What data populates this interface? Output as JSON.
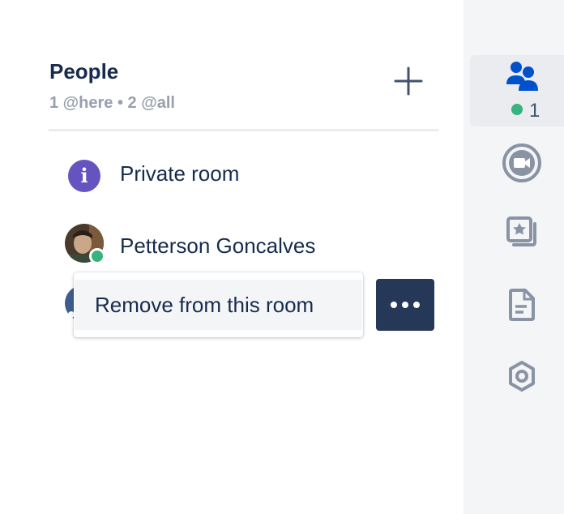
{
  "people_panel": {
    "title": "People",
    "subtitle": "1 @here • 2 @all",
    "add_icon": "plus-icon"
  },
  "rows": [
    {
      "label": "Private room",
      "icon": "info-icon",
      "icon_glyph": "i"
    },
    {
      "label": "Petterson Goncalves",
      "icon": "avatar",
      "status": "online"
    }
  ],
  "context_menu": {
    "items": [
      {
        "label": "Remove from this room"
      }
    ]
  },
  "more_button": {
    "icon": "more-horizontal-icon"
  },
  "right_rail": {
    "items": [
      {
        "name": "people",
        "icon": "people-icon",
        "active": true,
        "online_count": "1"
      },
      {
        "name": "video",
        "icon": "video-call-icon"
      },
      {
        "name": "collections",
        "icon": "star-gallery-icon"
      },
      {
        "name": "files",
        "icon": "document-icon"
      },
      {
        "name": "settings",
        "icon": "hexagon-settings-icon"
      }
    ]
  },
  "colors": {
    "primary_text": "#172b4d",
    "muted_text": "#97a0af",
    "online_green": "#36b37e",
    "info_purple": "#6554c0",
    "dark_button": "#253858",
    "active_blue": "#0052cc"
  }
}
